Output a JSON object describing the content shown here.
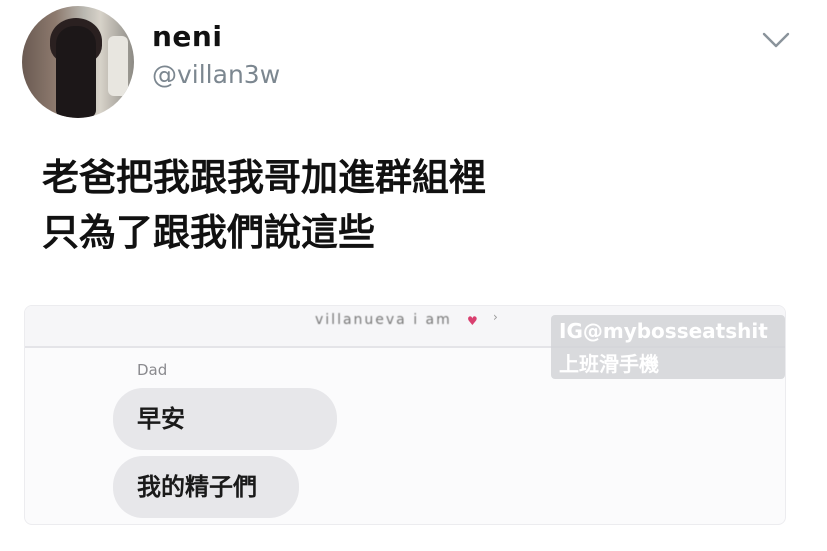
{
  "profile": {
    "name": "neni",
    "handle": "@villan3w"
  },
  "tweet": {
    "text": "老爸把我跟我哥加進群組裡\n只為了跟我們說這些"
  },
  "screenshot": {
    "top_name": "villanueva i am",
    "sender": "Dad",
    "messages": [
      "早安",
      "我的精子們"
    ]
  },
  "watermark": {
    "line1": "IG@mybosseatshit",
    "line2": "上班滑手機"
  },
  "icons": {
    "chevron": "chevron-down-icon",
    "heart": "heart-icon"
  },
  "colors": {
    "handle": "#7c8790",
    "bubble": "#e7e7ea",
    "heart": "#d94070"
  }
}
